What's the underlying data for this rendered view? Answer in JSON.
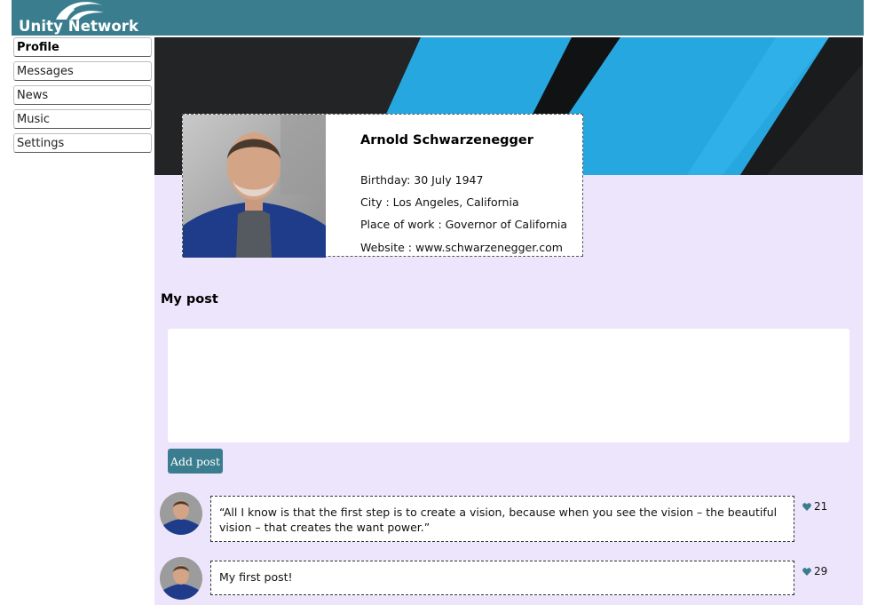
{
  "header": {
    "app_name": "Unity Network",
    "color": "#3a7d8e",
    "logo_icon": "unity-network-logo-icon"
  },
  "sidebar": {
    "items": [
      {
        "label": "Profile",
        "active": true
      },
      {
        "label": "Messages",
        "active": false
      },
      {
        "label": "News",
        "active": false
      },
      {
        "label": "Music",
        "active": false
      },
      {
        "label": "Settings",
        "active": false
      }
    ]
  },
  "profile": {
    "name": "Arnold Schwarzenegger",
    "birthday": "Birthday: 30 July 1947",
    "city": "City : Los Angeles, California",
    "work": "Place of work : Governor of California",
    "website": "Website : www.schwarzenegger.com"
  },
  "posts_section": {
    "title": "My post",
    "input_value": "",
    "add_button_label": "Add post",
    "posts": [
      {
        "text": "“All I know is that the first step is to create a vision, because when you see the vision – the beautiful vision – that creates the want power.”",
        "likes": "21"
      },
      {
        "text": "My first post!",
        "likes": "29"
      }
    ]
  },
  "colors": {
    "accent": "#3a7d8e",
    "page_background": "#ede5fc",
    "banner_blue": "#27a7e0",
    "banner_dark": "#232426"
  }
}
